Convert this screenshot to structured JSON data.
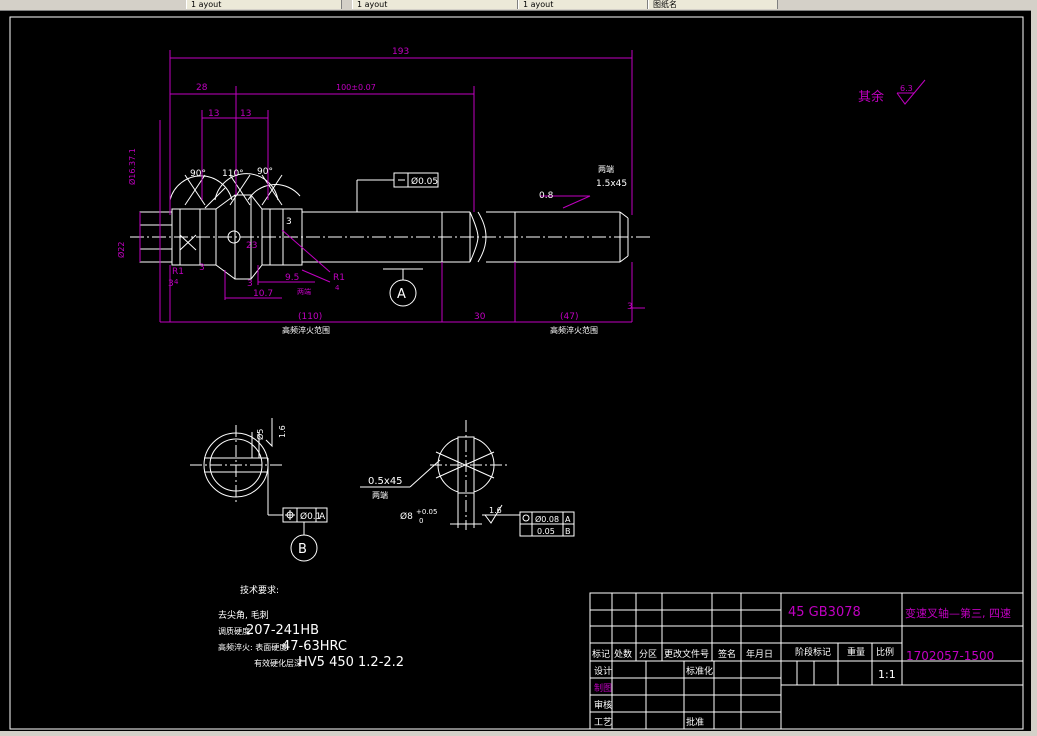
{
  "window": {
    "tabs": [
      "1 ayout",
      "1 ayout",
      "1 ayout",
      "图纸名"
    ]
  },
  "dims": {
    "overall": "193",
    "d28": "28",
    "d100": "100±0.07",
    "d13a": "13",
    "d13b": "13",
    "a90a": "90°",
    "a110": "110°",
    "a90b": "90°",
    "dia16": "Ø16.37.1",
    "dia22": "Ø22",
    "d3a": "3",
    "d3b": "3",
    "d3c": "3",
    "d3d": "3",
    "r1a": "R1",
    "r1b": "R1",
    "d4a": "4",
    "d4b": "4",
    "d23": "23",
    "d95": "9.5",
    "d107": "10.7",
    "d110": "(110)",
    "d30": "30",
    "d47": "(47)",
    "chamfer": "1.5x45",
    "chamfer_note": "两端",
    "ra08": "0.8",
    "both_ends": "两端",
    "zone1": "高频淬火范围",
    "zone2": "高频淬火范围",
    "tol_cyl": "Ø0.05",
    "datum_a": "A"
  },
  "section1": {
    "dia": "Ø5",
    "ra": "1.6",
    "tol": "Ø0.1",
    "tol_datum": "A",
    "datum_b": "B"
  },
  "section2": {
    "chamfer": "0.5x45",
    "chamfer_note": "两端",
    "dia": "Ø8",
    "tol_up": "+0.05",
    "tol_lo": "0",
    "ra": "1.6",
    "pos_tol": "Ø0.08",
    "pos_datum": "A",
    "sym_tol": "0.05",
    "sym_datum": "B"
  },
  "roughness": {
    "label": "其余",
    "value": "6.3"
  },
  "tech": {
    "title": "技术要求:",
    "line1": "去尖角, 毛刺",
    "line2_label": "调质硬度",
    "line2_value": "207-241HB",
    "line3_label": "高频淬火: 表面硬度",
    "line3_value": "47-63HRC",
    "line4_label": "有效硬化层深",
    "line4_value": "HV5 450 1.2-2.2"
  },
  "titleblock": {
    "material": "45 GB3078",
    "part_name": "变速叉轴—第三, 四速",
    "part_no": "1702057-1500",
    "headers": [
      "标记",
      "处数",
      "分区",
      "更改文件号",
      "签名",
      "年月日"
    ],
    "rows": [
      "设计",
      "制图",
      "审核",
      "工艺"
    ],
    "std": "标准化",
    "approve": "批准",
    "stage": "阶段标记",
    "weight": "重量",
    "scale": "比例",
    "scale_value": "1:1"
  }
}
